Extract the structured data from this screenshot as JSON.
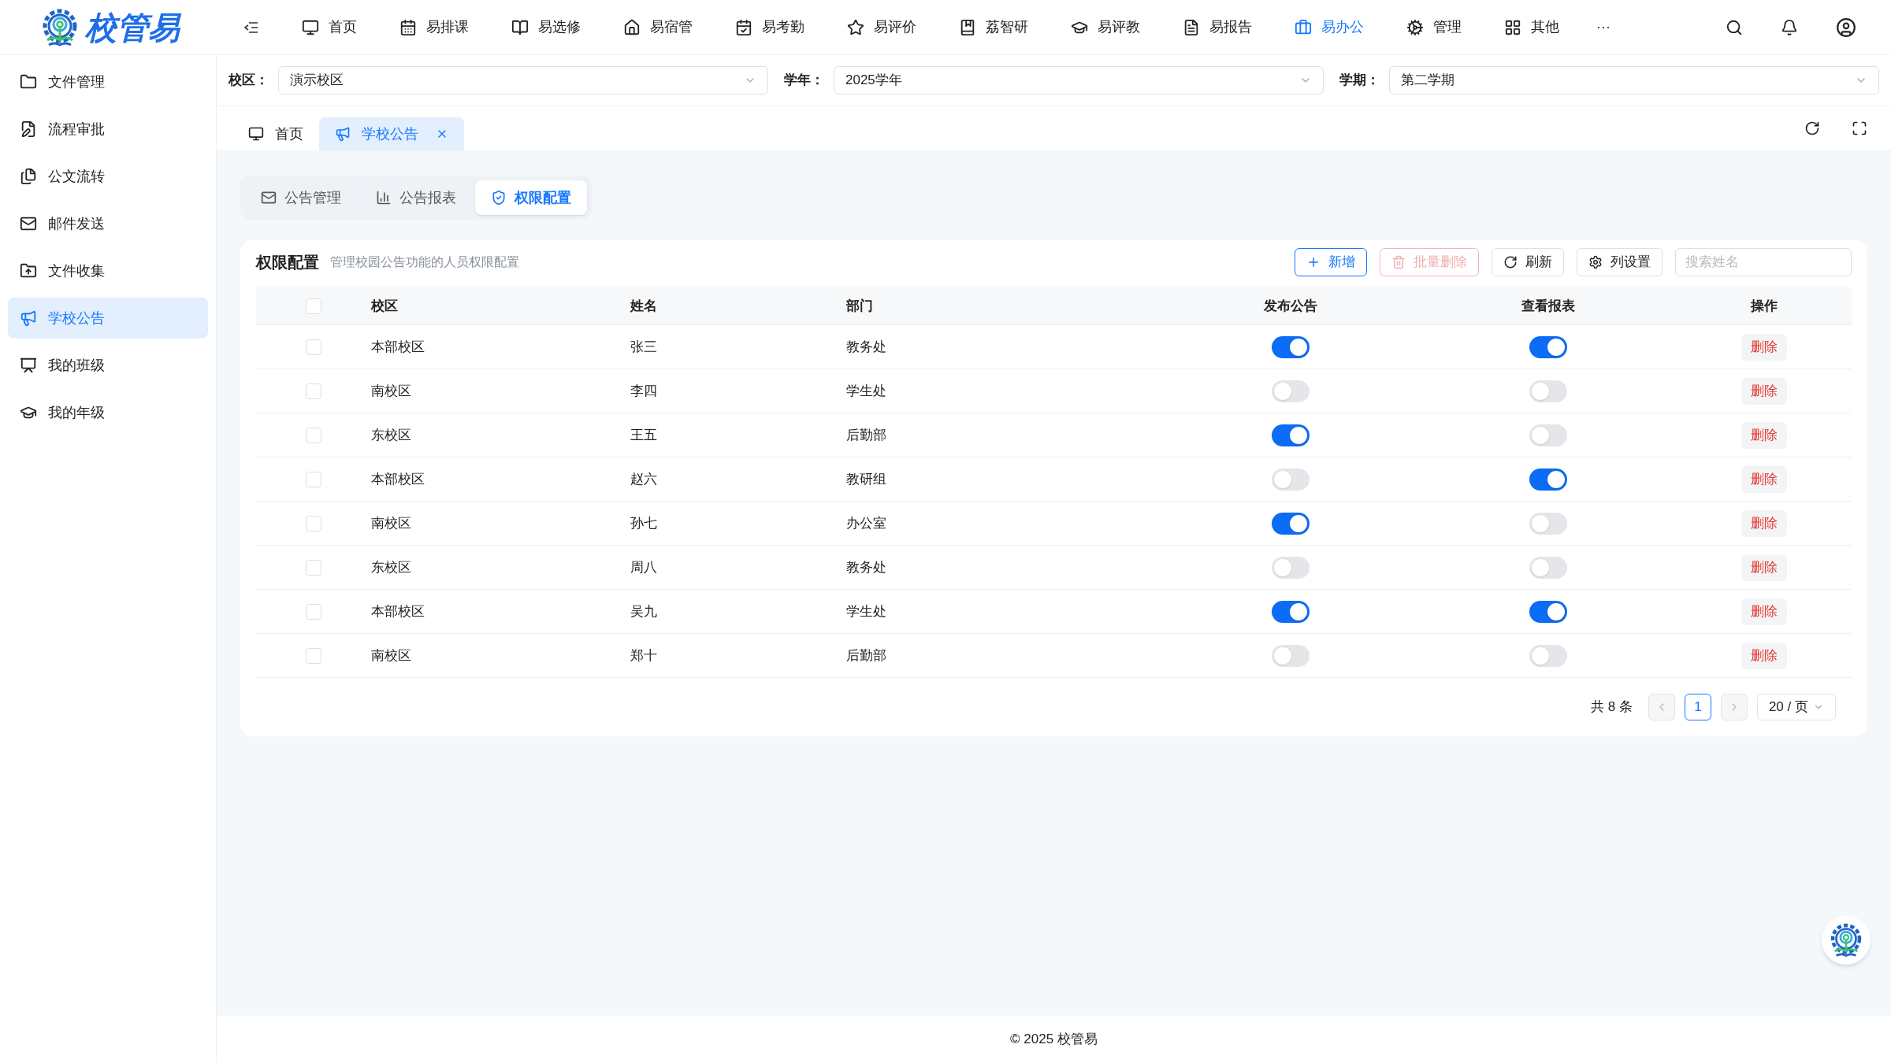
{
  "app": {
    "logo_text": "校管易"
  },
  "top_nav": [
    {
      "label": "首页",
      "selected": false
    },
    {
      "label": "易排课",
      "selected": false
    },
    {
      "label": "易选修",
      "selected": false
    },
    {
      "label": "易宿管",
      "selected": false
    },
    {
      "label": "易考勤",
      "selected": false
    },
    {
      "label": "易评价",
      "selected": false
    },
    {
      "label": "荔智研",
      "selected": false
    },
    {
      "label": "易评教",
      "selected": false
    },
    {
      "label": "易报告",
      "selected": false
    },
    {
      "label": "易办公",
      "selected": true
    },
    {
      "label": "管理",
      "selected": false
    },
    {
      "label": "其他",
      "selected": false
    }
  ],
  "more_label": "···",
  "sidebar": [
    {
      "label": "文件管理",
      "selected": false
    },
    {
      "label": "流程审批",
      "selected": false
    },
    {
      "label": "公文流转",
      "selected": false
    },
    {
      "label": "邮件发送",
      "selected": false
    },
    {
      "label": "文件收集",
      "selected": false
    },
    {
      "label": "学校公告",
      "selected": true
    },
    {
      "label": "我的班级",
      "selected": false
    },
    {
      "label": "我的年级",
      "selected": false
    }
  ],
  "filters": [
    {
      "label": "校区：",
      "value": "演示校区"
    },
    {
      "label": "学年：",
      "value": "2025学年"
    },
    {
      "label": "学期：",
      "value": "第二学期"
    }
  ],
  "page_tabs": [
    {
      "label": "首页",
      "selected": false,
      "closable": false
    },
    {
      "label": "学校公告",
      "selected": true,
      "closable": true
    }
  ],
  "sub_tabs": [
    {
      "label": "公告管理",
      "selected": false
    },
    {
      "label": "公告报表",
      "selected": false
    },
    {
      "label": "权限配置",
      "selected": true
    }
  ],
  "panel": {
    "title": "权限配置",
    "subtitle": "管理校园公告功能的人员权限配置",
    "buttons": [
      {
        "kind": "primary",
        "label": "新增",
        "disabled": false
      },
      {
        "kind": "danger",
        "label": "批量删除",
        "disabled": true
      },
      {
        "kind": "refresh",
        "label": "刷新",
        "disabled": false
      },
      {
        "kind": "settings",
        "label": "列设置",
        "disabled": false
      }
    ],
    "search": {
      "placeholder": "搜索姓名"
    }
  },
  "table": {
    "header_checked": false,
    "columns": [
      "校区",
      "姓名",
      "部门",
      "发布公告",
      "查看报表",
      "操作"
    ],
    "rows": [
      {
        "checked": false,
        "campus": "本部校区",
        "name": "张三",
        "dept": "教务处",
        "publish": true,
        "view_report": true,
        "action": "删除"
      },
      {
        "checked": false,
        "campus": "南校区",
        "name": "李四",
        "dept": "学生处",
        "publish": false,
        "view_report": false,
        "action": "删除"
      },
      {
        "checked": false,
        "campus": "东校区",
        "name": "王五",
        "dept": "后勤部",
        "publish": true,
        "view_report": false,
        "action": "删除"
      },
      {
        "checked": false,
        "campus": "本部校区",
        "name": "赵六",
        "dept": "教研组",
        "publish": false,
        "view_report": true,
        "action": "删除"
      },
      {
        "checked": false,
        "campus": "南校区",
        "name": "孙七",
        "dept": "办公室",
        "publish": true,
        "view_report": false,
        "action": "删除"
      },
      {
        "checked": false,
        "campus": "东校区",
        "name": "周八",
        "dept": "教务处",
        "publish": false,
        "view_report": false,
        "action": "删除"
      },
      {
        "checked": false,
        "campus": "本部校区",
        "name": "吴九",
        "dept": "学生处",
        "publish": true,
        "view_report": true,
        "action": "删除"
      },
      {
        "checked": false,
        "campus": "南校区",
        "name": "郑十",
        "dept": "后勤部",
        "publish": false,
        "view_report": false,
        "action": "删除"
      }
    ]
  },
  "pagination": {
    "total": "共 8 条",
    "prev_disabled": true,
    "next_disabled": true,
    "pages": [
      {
        "label": "1",
        "selected": true
      }
    ],
    "page_size": "20 / 页"
  },
  "footer": "© 2025 校管易"
}
